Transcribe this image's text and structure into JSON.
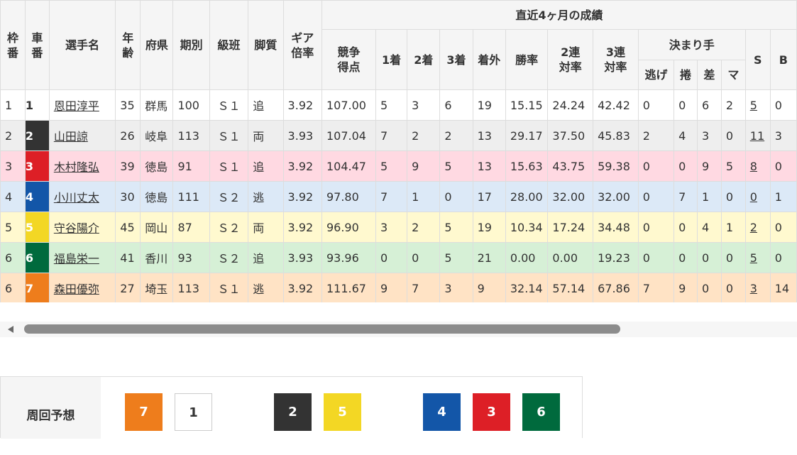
{
  "header": {
    "waku": "枠番",
    "sha": "車番",
    "name": "選手名",
    "age": "年齢",
    "pref": "府県",
    "term": "期別",
    "class": "級班",
    "legs": "脚質",
    "gear": "ギア倍率",
    "recent": "直近4ヶ月の成績",
    "score": "競争得点",
    "first": "1着",
    "second": "2着",
    "third": "3着",
    "out": "着外",
    "win_rate": "勝率",
    "quinella_rate": "2連対率",
    "trio_rate": "3連対率",
    "kimarite": "決まり手",
    "nige": "逃げ",
    "makuri": "捲",
    "sashi": "差",
    "mark": "マ",
    "s": "S",
    "b": "B"
  },
  "colors": {
    "car": {
      "1": "#ffffff",
      "2": "#333333",
      "3": "#dd1f26",
      "4": "#1356a8",
      "5": "#f3d724",
      "6": "#006a3d",
      "7": "#ee7d1c"
    },
    "row_bg": {
      "1": "#ffffff",
      "2": "#eeeeee",
      "3": "#ffd9e2",
      "4": "#dce9f7",
      "5": "#fff9cf",
      "6": "#d6f0d6",
      "7": "#ffe3c5"
    }
  },
  "rows": [
    {
      "waku": "1",
      "sha": "1",
      "name": "恩田淳平",
      "age": "35",
      "pref": "群馬",
      "term": "100",
      "class": "Ｓ１",
      "legs": "追",
      "gear": "3.92",
      "score": "107.00",
      "first": "5",
      "second": "3",
      "third": "6",
      "out": "19",
      "win_rate": "15.15",
      "quinella_rate": "24.24",
      "trio_rate": "42.42",
      "nige": "0",
      "makuri": "0",
      "sashi": "6",
      "mark": "2",
      "s": "5",
      "b": "0"
    },
    {
      "waku": "2",
      "sha": "2",
      "name": "山田諒",
      "age": "26",
      "pref": "岐阜",
      "term": "113",
      "class": "Ｓ１",
      "legs": "両",
      "gear": "3.93",
      "score": "107.04",
      "first": "7",
      "second": "2",
      "third": "2",
      "out": "13",
      "win_rate": "29.17",
      "quinella_rate": "37.50",
      "trio_rate": "45.83",
      "nige": "2",
      "makuri": "4",
      "sashi": "3",
      "mark": "0",
      "s": "11",
      "b": "3"
    },
    {
      "waku": "3",
      "sha": "3",
      "name": "木村隆弘",
      "age": "39",
      "pref": "徳島",
      "term": "91",
      "class": "Ｓ１",
      "legs": "追",
      "gear": "3.92",
      "score": "104.47",
      "first": "5",
      "second": "9",
      "third": "5",
      "out": "13",
      "win_rate": "15.63",
      "quinella_rate": "43.75",
      "trio_rate": "59.38",
      "nige": "0",
      "makuri": "0",
      "sashi": "9",
      "mark": "5",
      "s": "8",
      "b": "0"
    },
    {
      "waku": "4",
      "sha": "4",
      "name": "小川丈太",
      "age": "30",
      "pref": "徳島",
      "term": "111",
      "class": "Ｓ２",
      "legs": "逃",
      "gear": "3.92",
      "score": "97.80",
      "first": "7",
      "second": "1",
      "third": "0",
      "out": "17",
      "win_rate": "28.00",
      "quinella_rate": "32.00",
      "trio_rate": "32.00",
      "nige": "0",
      "makuri": "7",
      "sashi": "1",
      "mark": "0",
      "s": "0",
      "b": "1"
    },
    {
      "waku": "5",
      "sha": "5",
      "name": "守谷陽介",
      "age": "45",
      "pref": "岡山",
      "term": "87",
      "class": "Ｓ２",
      "legs": "両",
      "gear": "3.92",
      "score": "96.90",
      "first": "3",
      "second": "2",
      "third": "5",
      "out": "19",
      "win_rate": "10.34",
      "quinella_rate": "17.24",
      "trio_rate": "34.48",
      "nige": "0",
      "makuri": "0",
      "sashi": "4",
      "mark": "1",
      "s": "2",
      "b": "0"
    },
    {
      "waku": "6",
      "sha": "6",
      "name": "福島栄一",
      "age": "41",
      "pref": "香川",
      "term": "93",
      "class": "Ｓ２",
      "legs": "追",
      "gear": "3.93",
      "score": "93.96",
      "first": "0",
      "second": "0",
      "third": "5",
      "out": "21",
      "win_rate": "0.00",
      "quinella_rate": "0.00",
      "trio_rate": "19.23",
      "nige": "0",
      "makuri": "0",
      "sashi": "0",
      "mark": "0",
      "s": "5",
      "b": "0"
    },
    {
      "waku": "6",
      "sha": "7",
      "name": "森田優弥",
      "age": "27",
      "pref": "埼玉",
      "term": "113",
      "class": "Ｓ１",
      "legs": "逃",
      "gear": "3.92",
      "score": "111.67",
      "first": "9",
      "second": "7",
      "third": "3",
      "out": "9",
      "win_rate": "32.14",
      "quinella_rate": "57.14",
      "trio_rate": "67.86",
      "nige": "7",
      "makuri": "9",
      "sashi": "0",
      "mark": "0",
      "s": "3",
      "b": "14"
    }
  ],
  "prediction": {
    "label": "周回予想",
    "chips": [
      "7",
      "1",
      "2",
      "5",
      "4",
      "3",
      "6"
    ]
  }
}
